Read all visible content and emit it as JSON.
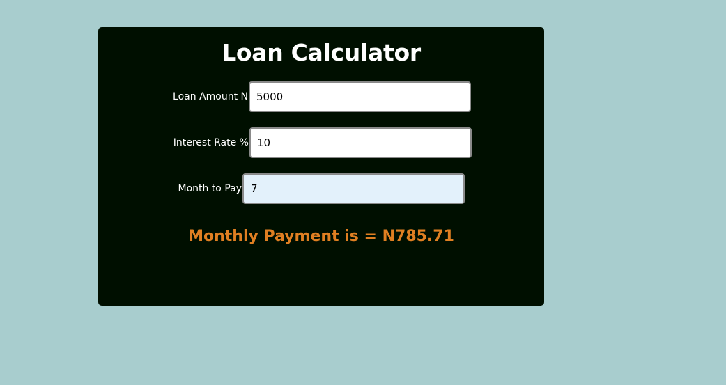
{
  "app": {
    "title": "Loan Calculator"
  },
  "form": {
    "loan_amount": {
      "label": "Loan Amount N",
      "value": "5000"
    },
    "interest_rate": {
      "label": "Interest Rate %",
      "value": "10"
    },
    "months": {
      "label": "Month to Pay",
      "value": "7"
    }
  },
  "result": {
    "text": "Monthly Payment is = N785.71"
  },
  "colors": {
    "background": "#a8cdce",
    "card": "#000f00",
    "result": "#e07f22",
    "focused_input": "#e3f1fb"
  }
}
